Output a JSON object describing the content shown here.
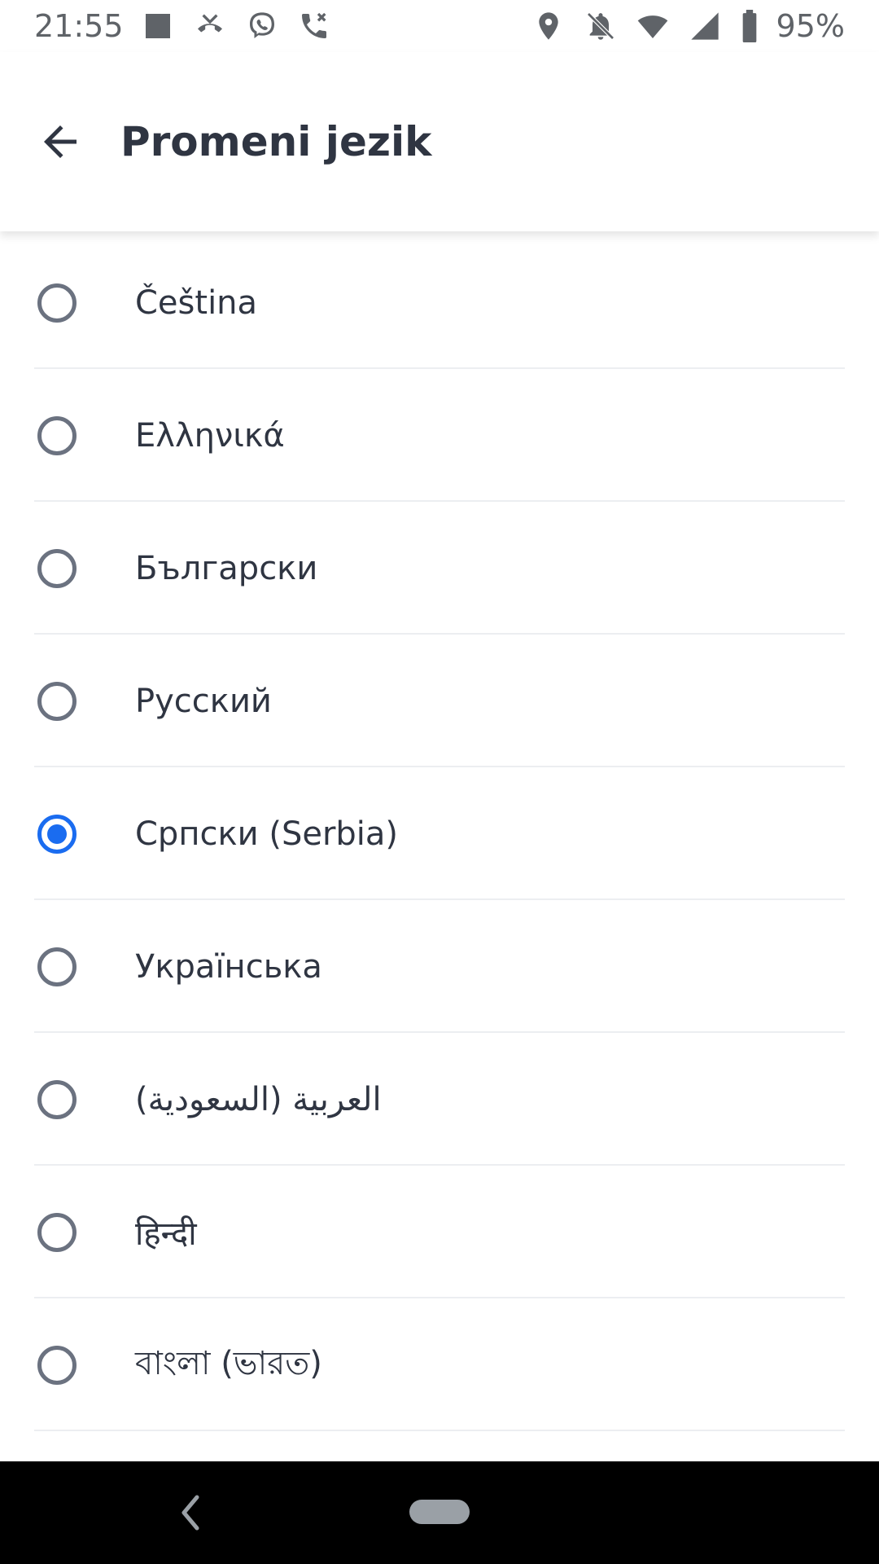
{
  "status_bar": {
    "time": "21:55",
    "battery_percent": "95%",
    "icons_left": [
      "image-thumbnail-icon",
      "missed-call-icon",
      "viber-icon",
      "call-muted-icon"
    ],
    "icons_right": [
      "location-icon",
      "notifications-off-icon",
      "wifi-icon",
      "cell-signal-icon",
      "battery-icon"
    ]
  },
  "header": {
    "title": "Promeni jezik",
    "back_icon": "arrow-left-icon"
  },
  "languages": [
    {
      "label": "Čeština",
      "selected": false
    },
    {
      "label": "Ελληνικά",
      "selected": false
    },
    {
      "label": "Български",
      "selected": false
    },
    {
      "label": "Русский",
      "selected": false
    },
    {
      "label": "Српски (Serbia)",
      "selected": true
    },
    {
      "label": "Українська",
      "selected": false
    },
    {
      "label": "العربية (السعودية)",
      "selected": false
    },
    {
      "label": "हिन्दी",
      "selected": false
    },
    {
      "label": "বাংলা (ভারত)",
      "selected": false
    }
  ],
  "colors": {
    "accent": "#1a6cf0",
    "text": "#2f3542",
    "radio_border": "#6b7280",
    "divider": "#eceef1"
  },
  "nav_bar": {
    "back_icon": "nav-back-icon",
    "home_icon": "nav-home-pill"
  }
}
